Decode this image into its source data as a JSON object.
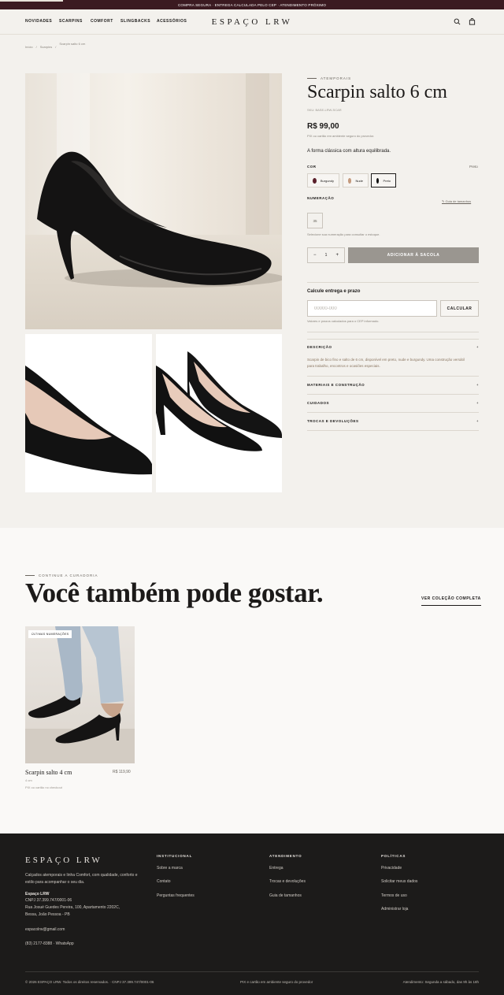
{
  "topbar": {
    "text": "COMPRA SEGURA · ENTREGA CALCULADA PELO CEP · ATENDIMENTO PRÓXIMO"
  },
  "header": {
    "nav": [
      "NOVIDADES",
      "SCARPINS",
      "COMFORT",
      "SLINGBACKS",
      "ACESSÓRIOS"
    ],
    "logo": "ESPAÇO LRW",
    "icons": [
      "search-icon",
      "bag-icon"
    ]
  },
  "breadcrumb": [
    "Início",
    "/",
    "Scarpins",
    "/",
    "Scarpin salto 6 cm"
  ],
  "product": {
    "eyebrow": "ATEMPORAIS",
    "title": "Scarpin salto 6 cm",
    "sku": "SKU: BASE-LRW-SCAR",
    "price": "R$ 99,00",
    "pix_note": "PIX ou cartão em ambiente seguro do provedor.",
    "description": "A forma clássica com altura equilibrada.",
    "color_label": "COR",
    "color_value": "Preto",
    "swatches": [
      {
        "name": "Burgundy",
        "color": "#5a1f2a"
      },
      {
        "name": "Nude",
        "color": "#c49a7e"
      },
      {
        "name": "Preto",
        "color": "#111111"
      }
    ],
    "size_label": "NUMERAÇÃO",
    "size_guide": "Guia de tamanhos",
    "size_placeholder": "35",
    "size_note": "Selecione sua numeração para consultar o estoque.",
    "qty_minus": "−",
    "qty_value": "1",
    "qty_plus": "+",
    "add_button": "ADICIONAR À SACOLA",
    "shipping_title": "Calcule entrega e prazo",
    "cep_placeholder": "00000-000",
    "calc_button": "CALCULAR",
    "cep_note": "Valores e prazos calculados para o CEP informado.",
    "accordions": [
      {
        "title": "DESCRIÇÃO",
        "icon": "+"
      },
      {
        "title": "MATERIAIS E CONSTRUÇÃO",
        "icon": "+"
      },
      {
        "title": "CUIDADOS",
        "icon": "+"
      },
      {
        "title": "TROCAS E DEVOLUÇÕES",
        "icon": "+"
      }
    ],
    "accordion_text": "Scarpin de bico fino e salto de 6 cm, disponível em preto, nude e burgundy. Uma construção versátil para trabalho, encontros e ocasiões especiais."
  },
  "recommend": {
    "eyebrow": "CONTINUE A CURADORIA",
    "title": "Você também pode gostar.",
    "view_all": "VER COLEÇÃO COMPLETA",
    "card": {
      "badge": "ÚLTIMAS NUMERAÇÕES",
      "name": "Scarpin salto 4 cm",
      "price": "R$ 119,90",
      "sub": "4 cm",
      "pix": "PIX ou cartão no checkout"
    }
  },
  "footer": {
    "logo": "ESPAÇO LRW",
    "about": "Calçados atemporais e linha Comfort, com qualidade, conforto e estilo para acompanhar o seu dia.",
    "company": "Espaço LRW",
    "cnpj": "CNPJ 37.399.747/0001-06",
    "address1": "Rua Josué Guedes Pereira, 100, Apartamento 2202C,",
    "address2": "Bessa, João Pessoa - PB",
    "email": "espacolrw@gmail.com",
    "phone": "(83) 2177-8388 · WhatsApp",
    "columns": [
      {
        "title": "INSTITUCIONAL",
        "links": [
          "Sobre a marca",
          "Contato",
          "Perguntas frequentes"
        ]
      },
      {
        "title": "ATENDIMENTO",
        "links": [
          "Entrega",
          "Trocas e devoluções",
          "Guia de tamanhos"
        ]
      },
      {
        "title": "POLÍTICAS",
        "links": [
          "Privacidade",
          "Solicitar meus dados",
          "Termos de uso",
          "Administrar loja"
        ]
      }
    ],
    "copyright": "© 2026 ESPAÇO LRW. Todos os direitos reservados. · CNPJ 37.399.747/0001-06",
    "payment": "PIX e cartão em ambiente seguro do provedor",
    "hours": "Atendimento: Segunda a sábado, das 9h às 18h"
  }
}
